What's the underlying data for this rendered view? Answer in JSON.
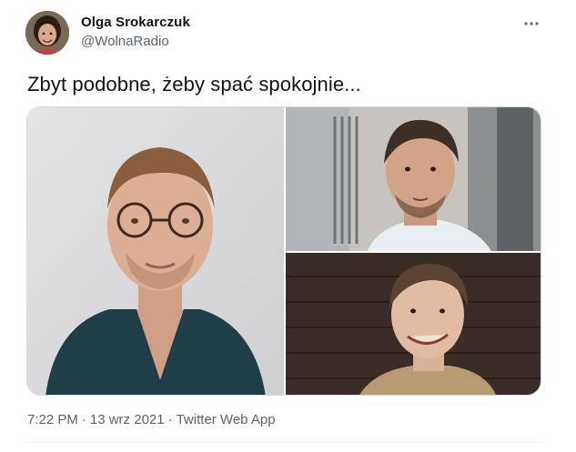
{
  "tweet": {
    "author": {
      "display_name": "Olga Srokarczuk",
      "handle": "@WolnaRadio",
      "avatar_icon": "profile-photo"
    },
    "text": "Zbyt podobne, żeby spać spokojnie...",
    "media": [
      {
        "name": "photo-man-with-glasses",
        "icon": "photo"
      },
      {
        "name": "photo-man-outdoors",
        "icon": "photo"
      },
      {
        "name": "photo-man-smiling",
        "icon": "photo"
      }
    ],
    "meta": {
      "time": "7:22 PM",
      "separator": "·",
      "date": "13 wrz 2021",
      "source": "Twitter Web App"
    },
    "more_icon": "more-horizontal-icon"
  },
  "colors": {
    "text_primary": "#0f1419",
    "text_secondary": "#536471",
    "border": "#cfd9de"
  }
}
